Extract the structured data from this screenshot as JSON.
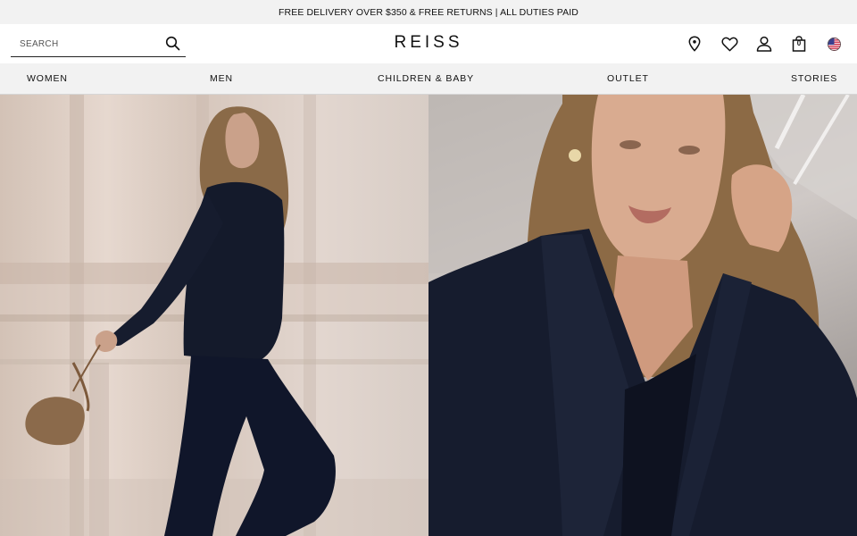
{
  "promo": {
    "text": "FREE DELIVERY OVER $350 & FREE RETURNS | ALL DUTIES PAID"
  },
  "header": {
    "search_placeholder": "SEARCH",
    "logo": "REISS",
    "bag_count": "0",
    "icons": [
      "location-pin-icon",
      "heart-icon",
      "account-icon",
      "shopping-bag-icon",
      "us-flag-icon"
    ]
  },
  "nav": {
    "items": [
      {
        "label": "WOMEN"
      },
      {
        "label": "MEN"
      },
      {
        "label": "CHILDREN & BABY"
      },
      {
        "label": "OUTLET"
      },
      {
        "label": "STORIES"
      }
    ]
  },
  "colors": {
    "promo_bg": "#f2f2f2",
    "nav_bg": "#f2f2f2",
    "text": "#111111",
    "navy": "#161c2e"
  }
}
